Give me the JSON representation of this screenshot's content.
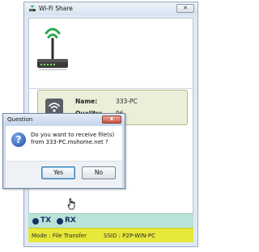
{
  "window": {
    "title": "Wi-Fi Share",
    "close_glyph": "✕"
  },
  "info": {
    "name_label": "Name:",
    "name_value": "333-PC",
    "quality_label": "Quality:",
    "quality_value": "96"
  },
  "status": {
    "tx_label": "TX",
    "rx_label": "RX"
  },
  "mode_bar": {
    "mode": "Mode : File Transfer",
    "ssid": "SSID : P2P-WIN-PC"
  },
  "dialog": {
    "title": "Question",
    "message": "Do you want to receive file(s) from 333-PC.mshome.net ?",
    "yes_label": "Yes",
    "no_label": "No",
    "close_glyph": "x"
  },
  "icons": {
    "app": "wifi-router-icon",
    "router": "wifi-router-icon",
    "signal": "wifi-signal-icon",
    "question": "question-icon",
    "cursor": "mouse-cursor-icon"
  },
  "colors": {
    "status_bar": "#b8e3d9",
    "mode_bar": "#e6e83a",
    "wifi_green": "#2aa84a",
    "dot_navy": "#1a2f66"
  }
}
